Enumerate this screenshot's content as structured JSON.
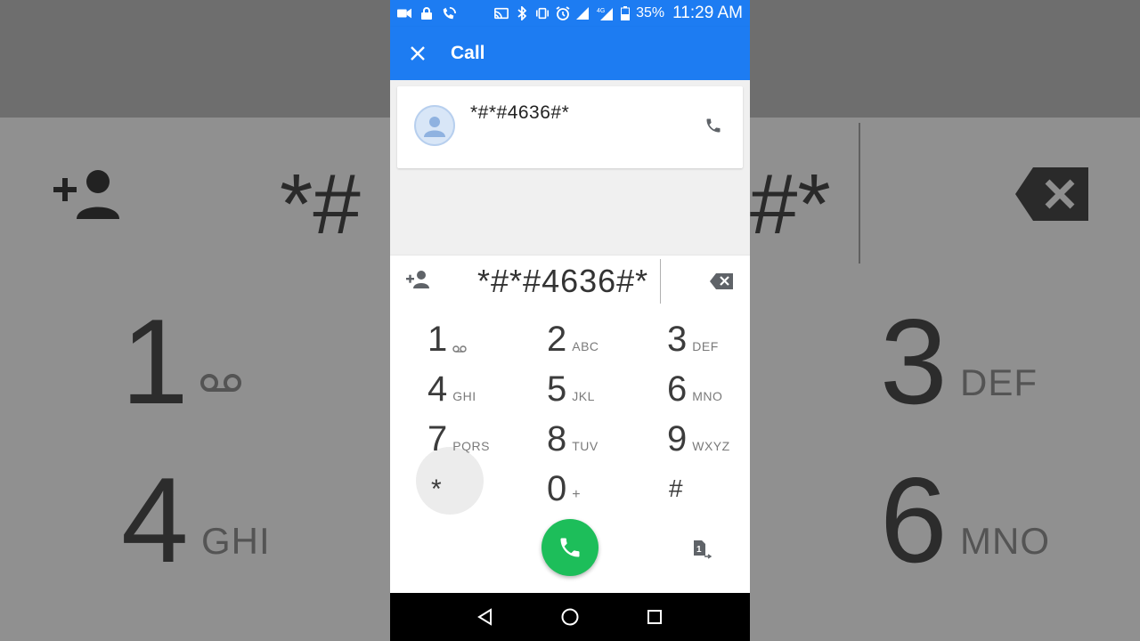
{
  "background": {
    "keys": [
      {
        "num": "1",
        "letters": "∞"
      },
      {
        "num": "3",
        "letters": "DEF"
      },
      {
        "num": "4",
        "letters": "GHI"
      },
      {
        "num": "6",
        "letters": "MNO"
      }
    ],
    "digits_left": "*#",
    "digits_right": "#*"
  },
  "status_bar": {
    "battery_percent": "35%",
    "time": "11:29 AM",
    "network": "4G"
  },
  "app_bar": {
    "title": "Call"
  },
  "search_result": {
    "number": "*#*#4636#*"
  },
  "dialpad": {
    "digits": "*#*#4636#*",
    "keys": [
      {
        "num": "1",
        "letters": "∞"
      },
      {
        "num": "2",
        "letters": "ABC"
      },
      {
        "num": "3",
        "letters": "DEF"
      },
      {
        "num": "4",
        "letters": "GHI"
      },
      {
        "num": "5",
        "letters": "JKL"
      },
      {
        "num": "6",
        "letters": "MNO"
      },
      {
        "num": "7",
        "letters": "PQRS"
      },
      {
        "num": "8",
        "letters": "TUV"
      },
      {
        "num": "9",
        "letters": "WXYZ"
      },
      {
        "num": "*",
        "letters": ""
      },
      {
        "num": "0",
        "letters": "+"
      },
      {
        "num": "#",
        "letters": ""
      }
    ],
    "sim_label": "1"
  },
  "colors": {
    "primary": "#1d7cf2",
    "call_green": "#1dbe5a",
    "navbar": "#000000"
  }
}
